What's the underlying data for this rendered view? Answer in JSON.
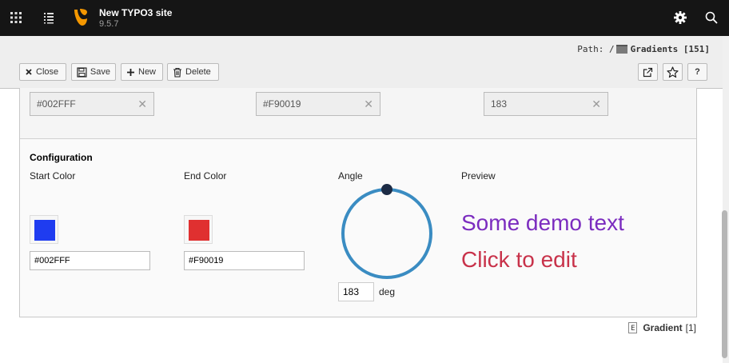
{
  "topbar": {
    "site_name": "New TYPO3 site",
    "version": "9.5.7"
  },
  "docheader": {
    "path_prefix": "Path: /",
    "path_page": "Gradients [151]",
    "buttons": {
      "close": "Close",
      "save": "Save",
      "new": "New",
      "delete": "Delete",
      "help": "?"
    }
  },
  "fields": {
    "start_color": "#002FFF",
    "end_color": "#F90019",
    "angle": "183"
  },
  "configuration": {
    "title": "Configuration",
    "start_color_label": "Start Color",
    "end_color_label": "End Color",
    "angle_label": "Angle",
    "preview_label": "Preview",
    "start_color_value": "#002FFF",
    "end_color_value": "#F90019",
    "angle_value": "183",
    "angle_unit": "deg",
    "preview_text_1": "Some demo text",
    "preview_text_2": "Click to edit"
  },
  "record": {
    "icon_letter": "E",
    "title": "Gradient",
    "uid": "[1]"
  },
  "colors": {
    "start": "#1f3cf0",
    "end": "#e03030",
    "dial": "#3a8cc2",
    "handle": "#1c2b45",
    "preview_1": "#7b2cbf",
    "preview_2": "#c8324a"
  }
}
